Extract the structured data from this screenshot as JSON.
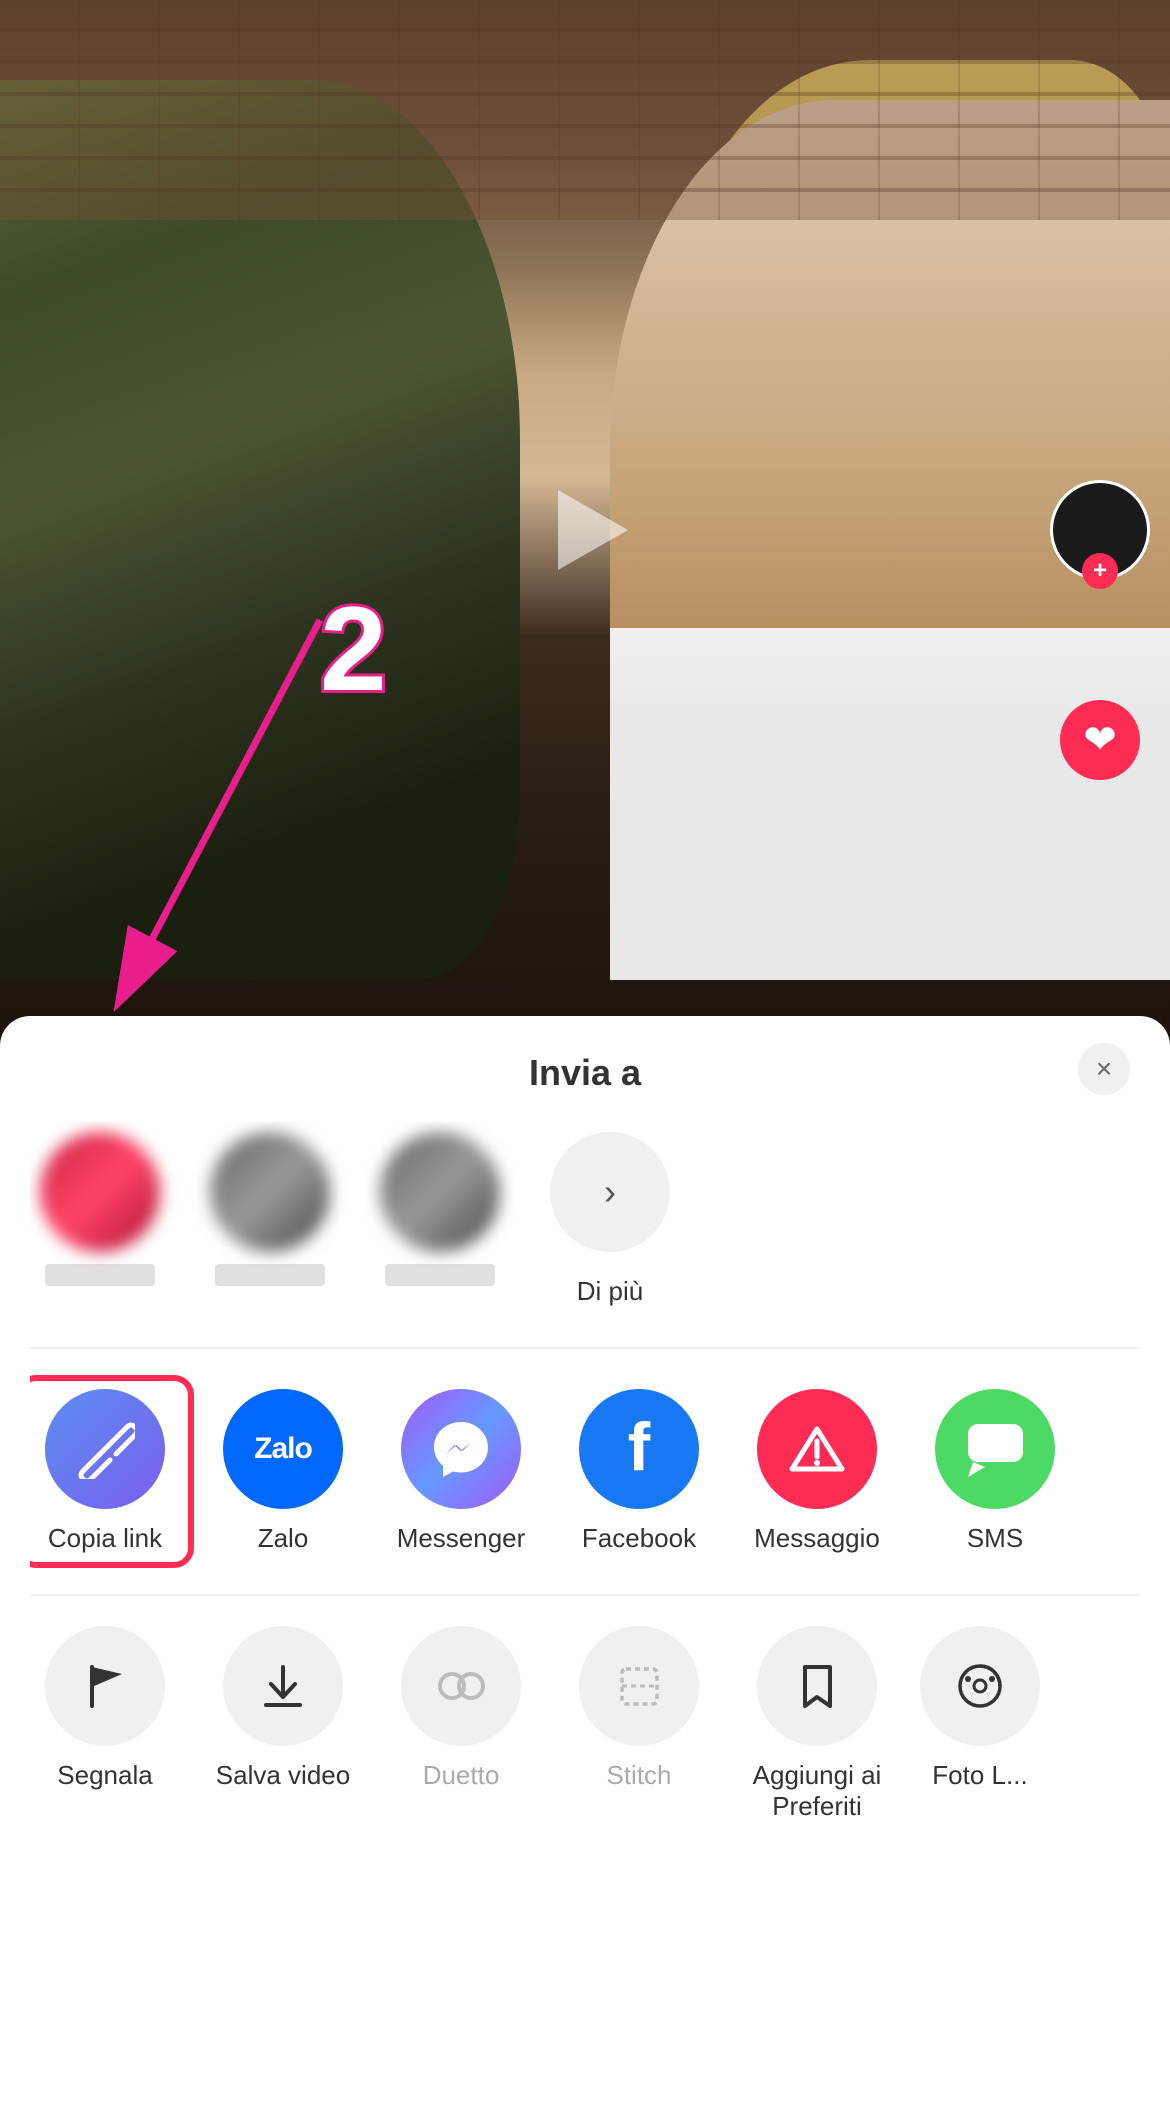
{
  "video": {
    "alt": "Two people video"
  },
  "annotation": {
    "number": "2"
  },
  "sidebar": {
    "plus_label": "+",
    "heart_label": "♥"
  },
  "sheet": {
    "title": "Invia a",
    "close_label": "×",
    "more_label": "Di più",
    "contacts": [
      {
        "name": "",
        "blurred": "red"
      },
      {
        "name": "",
        "blurred": "gray"
      },
      {
        "name": "",
        "blurred": "gray"
      }
    ],
    "apps": [
      {
        "id": "copy-link",
        "label": "Copia link",
        "icon": "🔗"
      },
      {
        "id": "zalo",
        "label": "Zalo",
        "icon": "Zalo"
      },
      {
        "id": "messenger",
        "label": "Messenger",
        "icon": "m"
      },
      {
        "id": "facebook",
        "label": "Facebook",
        "icon": "f"
      },
      {
        "id": "messaggio",
        "label": "Messaggio",
        "icon": "▽"
      },
      {
        "id": "sms",
        "label": "SMS",
        "icon": "💬"
      }
    ],
    "actions": [
      {
        "id": "segnala",
        "label": "Segnala"
      },
      {
        "id": "salva-video",
        "label": "Salva video"
      },
      {
        "id": "duetto",
        "label": "Duetto"
      },
      {
        "id": "stitch",
        "label": "Stitch"
      },
      {
        "id": "aggiungi-preferiti",
        "label": "Aggiungi ai Preferiti"
      },
      {
        "id": "foto",
        "label": "Foto L..."
      }
    ]
  }
}
